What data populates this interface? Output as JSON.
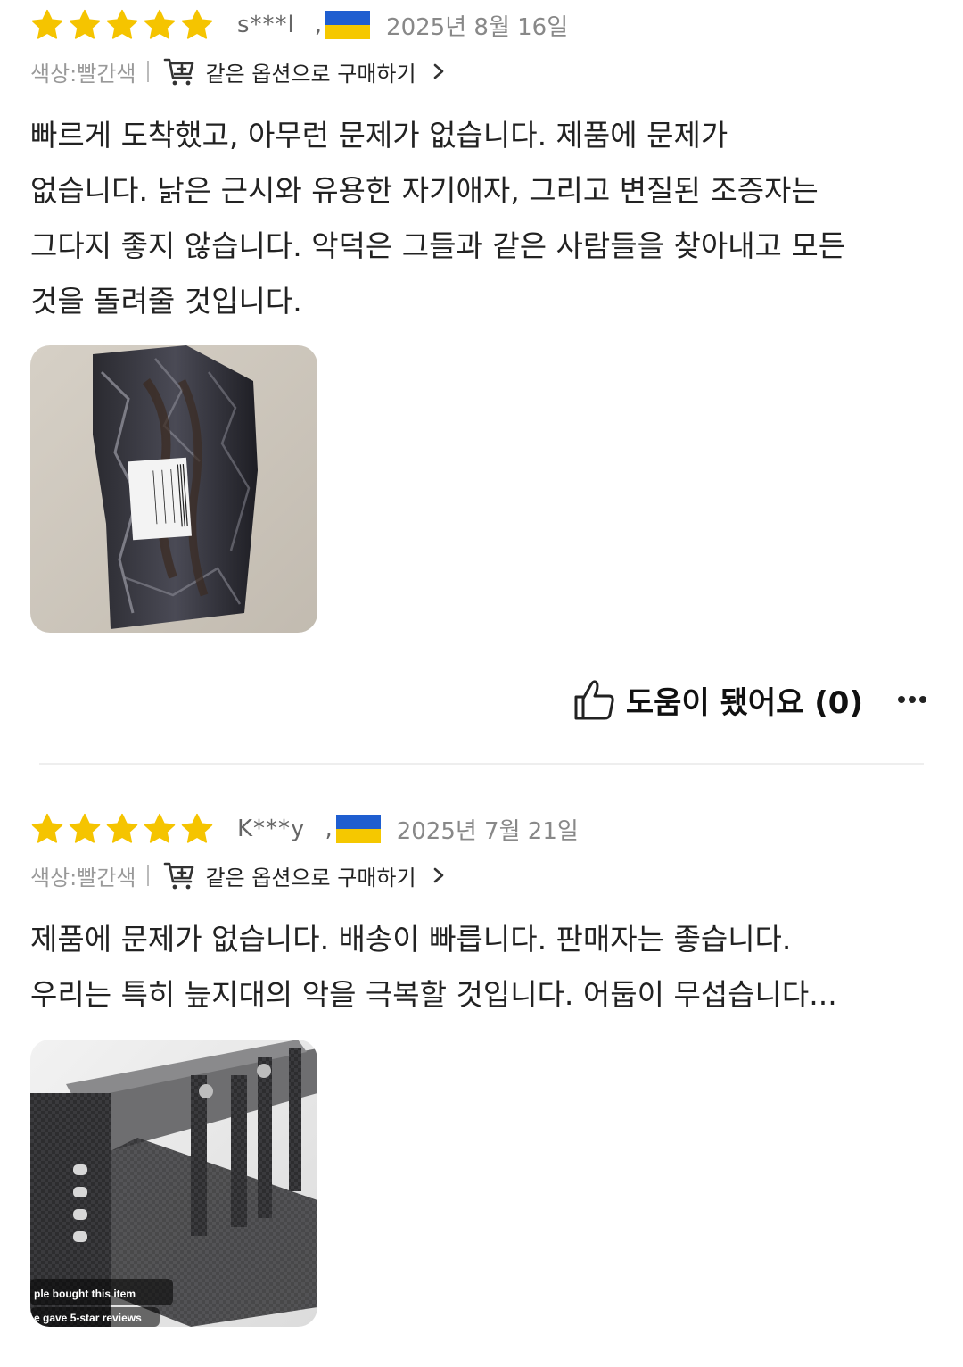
{
  "reviews": [
    {
      "rating": 5,
      "username": "s***l",
      "separator": ",",
      "country_flag": "ukraine",
      "date": "2025년 8월 16일",
      "option": "색상:빨간색",
      "buy_same_label": "같은 옵션으로 구매하기",
      "text_lines": [
        "빠르게 도착했고, 아무런 문제가 없습니다. 제품에 문제가",
        "없습니다. 낡은 근시와 유용한 자기애자, 그리고 변질된 조증자는",
        "그다지 좋지 않습니다. 악덕은 그들과 같은 사람들을 찾아내고 모든",
        "것을 돌려줄 것입니다."
      ],
      "helpful_label": "도움이 됐어요 (0)"
    },
    {
      "rating": 5,
      "username": "K***y",
      "separator": ",",
      "country_flag": "ukraine",
      "date": "2025년 7월 21일",
      "option": "색상:빨간색",
      "buy_same_label": "같은 옵션으로 구매하기",
      "text_lines": [
        "제품에 문제가 없습니다. 배송이 빠릅니다. 판매자는 좋습니다.",
        "우리는 특히 늪지대의 악을 극복할 것입니다. 어둡이 무섭습니다..."
      ],
      "photo_caption_1": "ple bought this item",
      "photo_caption_2": "e gave 5-star reviews"
    }
  ],
  "colors": {
    "star": "#f5c400",
    "flag_blue": "#1f5ed0",
    "flag_yellow": "#f5c800"
  },
  "icons": [
    "star-icon",
    "ukraine-flag-icon",
    "cart-plus-icon",
    "chevron-right-icon",
    "thumbs-up-icon",
    "more-icon"
  ]
}
